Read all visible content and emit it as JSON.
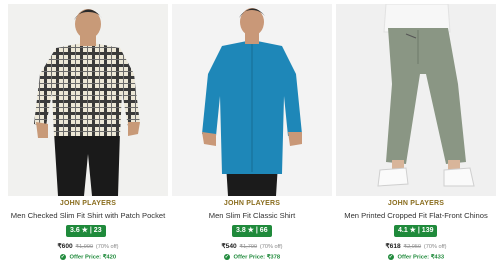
{
  "products": [
    {
      "brand": "JOHN PLAYERS",
      "title": "Men Checked Slim Fit Shirt with Patch Pocket",
      "rating": "3.6 ★ | 23",
      "price": "₹600",
      "mrp": "₹1,999",
      "discount": "(70% off)",
      "offer": "Offer Price: ₹420"
    },
    {
      "brand": "JOHN PLAYERS",
      "title": "Men Slim Fit Classic Shirt",
      "rating": "3.8 ★ | 66",
      "price": "₹540",
      "mrp": "₹1,799",
      "discount": "(70% off)",
      "offer": "Offer Price: ₹378"
    },
    {
      "brand": "JOHN PLAYERS",
      "title": "Men Printed Cropped Fit Flat-Front Chinos",
      "rating": "4.1 ★ | 139",
      "price": "₹618",
      "mrp": "₹2,059",
      "discount": "(70% off)",
      "offer": "Offer Price: ₹433"
    }
  ],
  "colors": {
    "brand": "#8a6d1e",
    "rating_badge": "#1f8a3b",
    "offer": "#1f8a3b"
  },
  "icons": [
    "check-circle-icon"
  ]
}
